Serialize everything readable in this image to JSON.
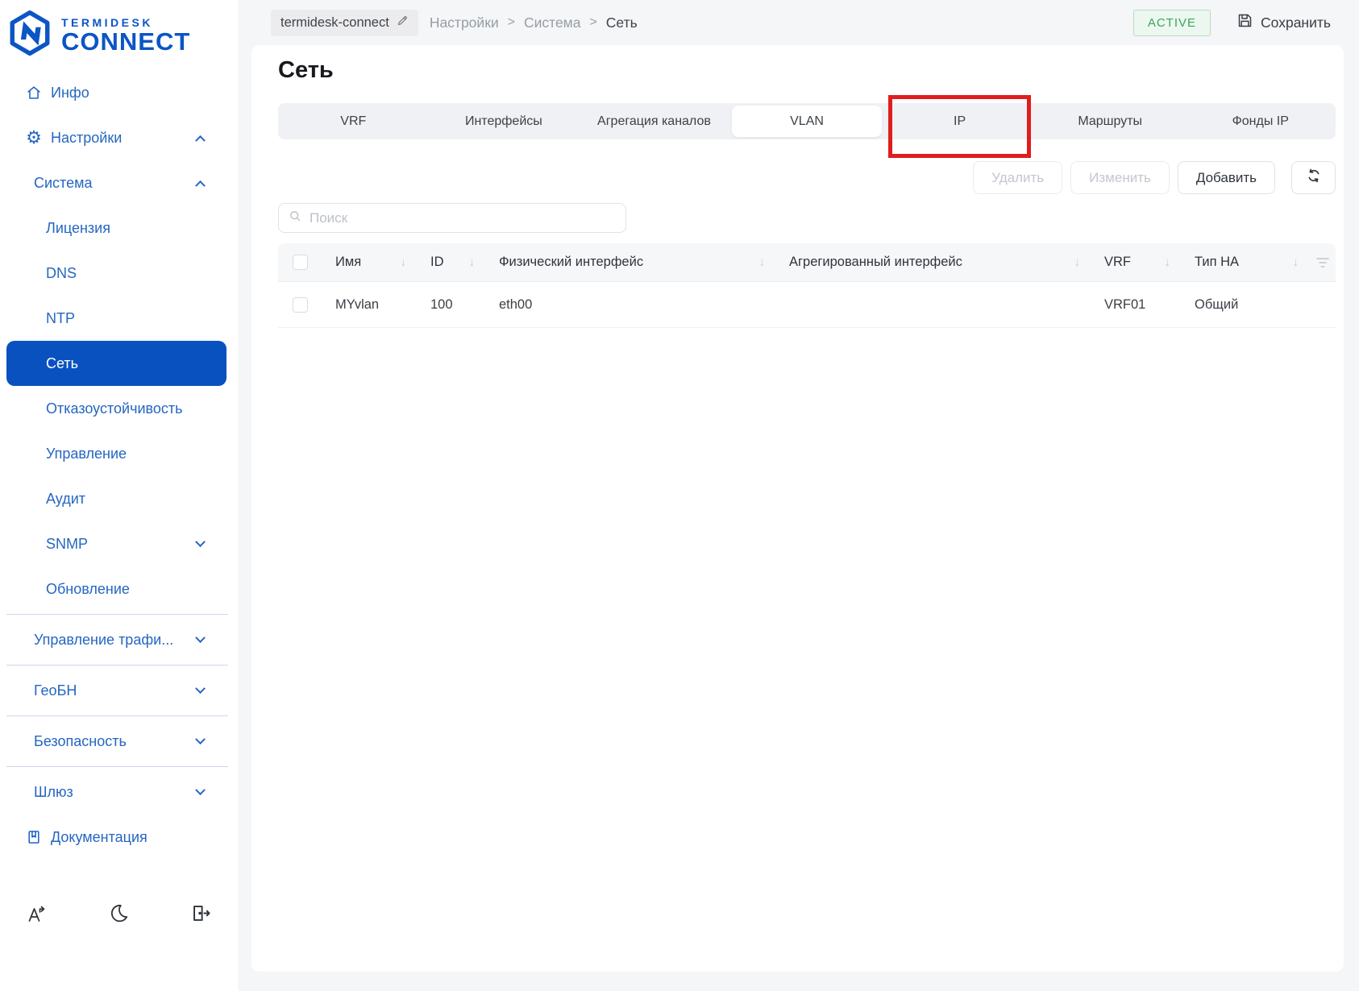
{
  "brand": {
    "name_top": "TERMIDESK",
    "name_bottom": "CONNECT"
  },
  "topbar": {
    "hostname": "termidesk-connect",
    "breadcrumb": {
      "items": [
        "Настройки",
        "Система",
        "Сеть"
      ],
      "separator": ">"
    },
    "status": "ACTIVE",
    "save": "Сохранить"
  },
  "sidebar": {
    "items": [
      {
        "label": "Инфо",
        "icon": "home-icon"
      },
      {
        "label": "Настройки",
        "icon": "gear-icon",
        "chevron": "up"
      },
      {
        "label": "Система",
        "chevron": "up"
      },
      {
        "label": "Лицензия"
      },
      {
        "label": "DNS"
      },
      {
        "label": "NTP"
      },
      {
        "label": "Сеть",
        "selected": true
      },
      {
        "label": "Отказоустойчивость"
      },
      {
        "label": "Управление"
      },
      {
        "label": "Аудит"
      },
      {
        "label": "SNMP",
        "chevron": "down"
      },
      {
        "label": "Обновление"
      },
      {
        "label": "Управление трафи...",
        "chevron": "down"
      },
      {
        "label": "ГеоБН",
        "chevron": "down"
      },
      {
        "label": "Безопасность",
        "chevron": "down"
      },
      {
        "label": "Шлюз",
        "chevron": "down"
      },
      {
        "label": "Документация",
        "icon": "book-icon"
      }
    ],
    "footer_icons": [
      "font-scale-icon",
      "dark-mode-icon",
      "logout-icon"
    ]
  },
  "page": {
    "title": "Сеть",
    "tabs": [
      "VRF",
      "Интерфейсы",
      "Агрегация каналов",
      "VLAN",
      "IP",
      "Маршруты",
      "Фонды IP"
    ],
    "active_tab": "VLAN",
    "annotated_tab": "IP",
    "toolbar": {
      "delete": "Удалить",
      "edit": "Изменить",
      "add": "Добавить"
    },
    "search_placeholder": "Поиск",
    "table": {
      "headers": {
        "name": "Имя",
        "id": "ID",
        "phys": "Физический интерфейс",
        "aggr": "Агрегированный интерфейс",
        "vrf": "VRF",
        "ha": "Тип HA"
      },
      "rows": [
        {
          "name": "MYvlan",
          "id": "100",
          "phys": "eth00",
          "aggr": "",
          "vrf": "VRF01",
          "ha": "Общий"
        }
      ]
    }
  },
  "colors": {
    "accent_blue": "#0c55c5",
    "sidebar_link": "#2566c2",
    "selected_item_bg": "#0a51c0",
    "status_green": "#3aa55d",
    "annotation_red": "#e11c1c"
  }
}
